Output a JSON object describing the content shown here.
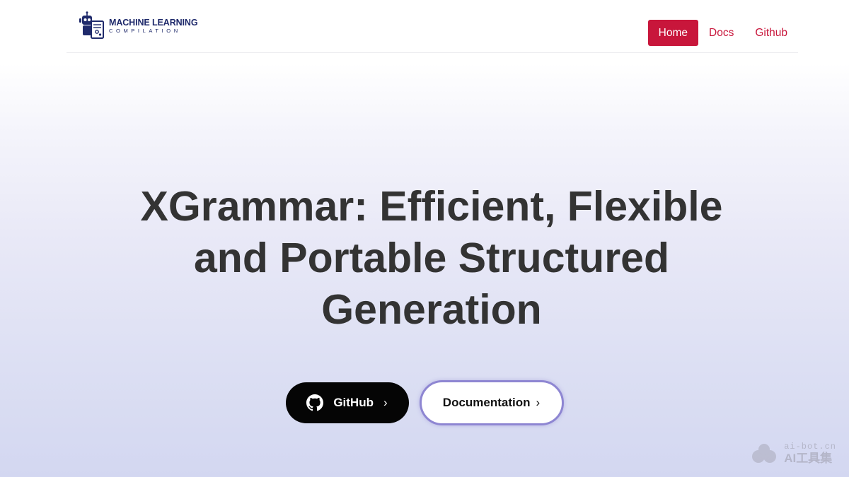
{
  "brand": {
    "logo_icon": "robot-notebook-icon",
    "line1": "MACHINE LEARNING",
    "line2": "COMPILATION",
    "color": "#1f2a6b"
  },
  "nav": {
    "accent_color": "#c8163b",
    "items": [
      {
        "label": "Home",
        "active": true
      },
      {
        "label": "Docs",
        "active": false
      },
      {
        "label": "Github",
        "active": false
      }
    ]
  },
  "hero": {
    "title_lines": [
      "XGrammar: Efficient, Flexible",
      "and Portable Structured",
      "Generation"
    ],
    "primary_button": {
      "label": "GitHub",
      "icon": "github-icon",
      "chevron": "›"
    },
    "secondary_button": {
      "label": "Documentation",
      "chevron": "›"
    }
  },
  "watermark": {
    "line1": "ai-bot.cn",
    "line2": "AI工具集"
  }
}
